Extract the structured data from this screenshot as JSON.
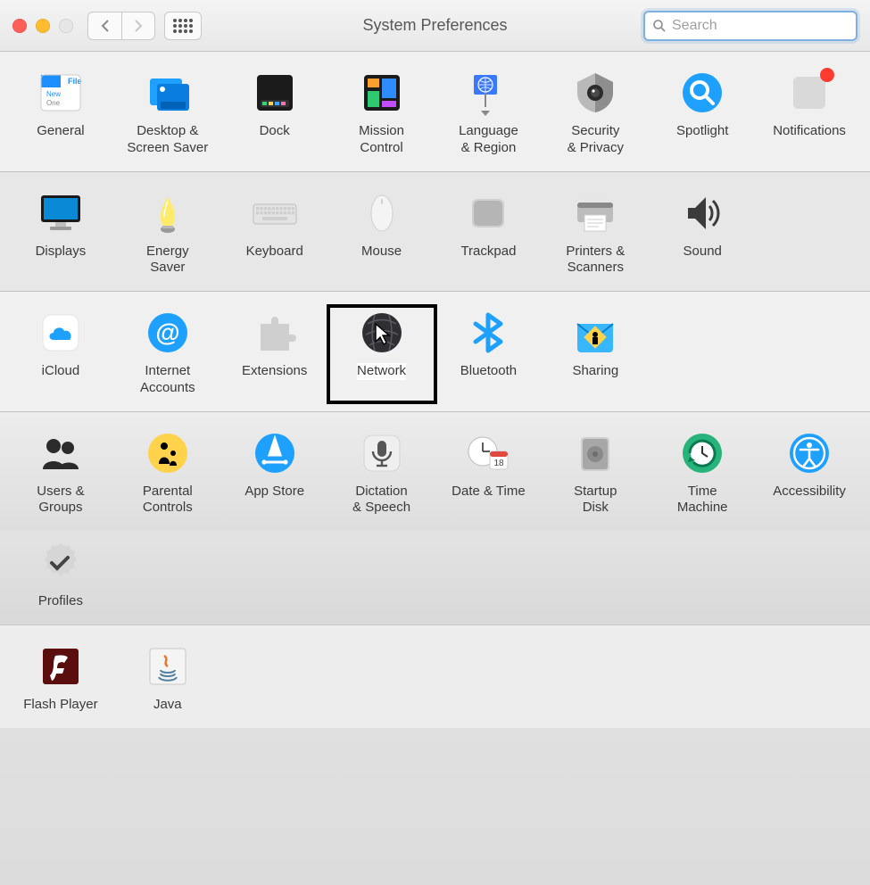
{
  "window": {
    "title": "System Preferences"
  },
  "search": {
    "placeholder": "Search",
    "value": ""
  },
  "rows": [
    [
      {
        "id": "general",
        "label": "General"
      },
      {
        "id": "desktop",
        "label": "Desktop &\nScreen Saver"
      },
      {
        "id": "dock",
        "label": "Dock"
      },
      {
        "id": "mission",
        "label": "Mission\nControl"
      },
      {
        "id": "language",
        "label": "Language\n& Region"
      },
      {
        "id": "security",
        "label": "Security\n& Privacy"
      },
      {
        "id": "spotlight",
        "label": "Spotlight"
      },
      {
        "id": "notifications",
        "label": "Notifications",
        "badge": true
      }
    ],
    [
      {
        "id": "displays",
        "label": "Displays"
      },
      {
        "id": "energy",
        "label": "Energy\nSaver"
      },
      {
        "id": "keyboard",
        "label": "Keyboard"
      },
      {
        "id": "mouse",
        "label": "Mouse"
      },
      {
        "id": "trackpad",
        "label": "Trackpad"
      },
      {
        "id": "printers",
        "label": "Printers &\nScanners"
      },
      {
        "id": "sound",
        "label": "Sound"
      }
    ],
    [
      {
        "id": "icloud",
        "label": "iCloud"
      },
      {
        "id": "internet",
        "label": "Internet\nAccounts"
      },
      {
        "id": "extensions",
        "label": "Extensions"
      },
      {
        "id": "network",
        "label": "Network",
        "highlight": true,
        "cursor": true
      },
      {
        "id": "bluetooth",
        "label": "Bluetooth"
      },
      {
        "id": "sharing",
        "label": "Sharing"
      }
    ],
    [
      {
        "id": "users",
        "label": "Users &\nGroups"
      },
      {
        "id": "parental",
        "label": "Parental\nControls"
      },
      {
        "id": "appstore",
        "label": "App Store"
      },
      {
        "id": "dictation",
        "label": "Dictation\n& Speech"
      },
      {
        "id": "datetime",
        "label": "Date & Time",
        "sub": "18"
      },
      {
        "id": "startup",
        "label": "Startup\nDisk"
      },
      {
        "id": "timemachine",
        "label": "Time\nMachine"
      },
      {
        "id": "accessibility",
        "label": "Accessibility"
      }
    ],
    [
      {
        "id": "profiles",
        "label": "Profiles"
      }
    ],
    [
      {
        "id": "flash",
        "label": "Flash Player"
      },
      {
        "id": "java",
        "label": "Java"
      }
    ]
  ]
}
